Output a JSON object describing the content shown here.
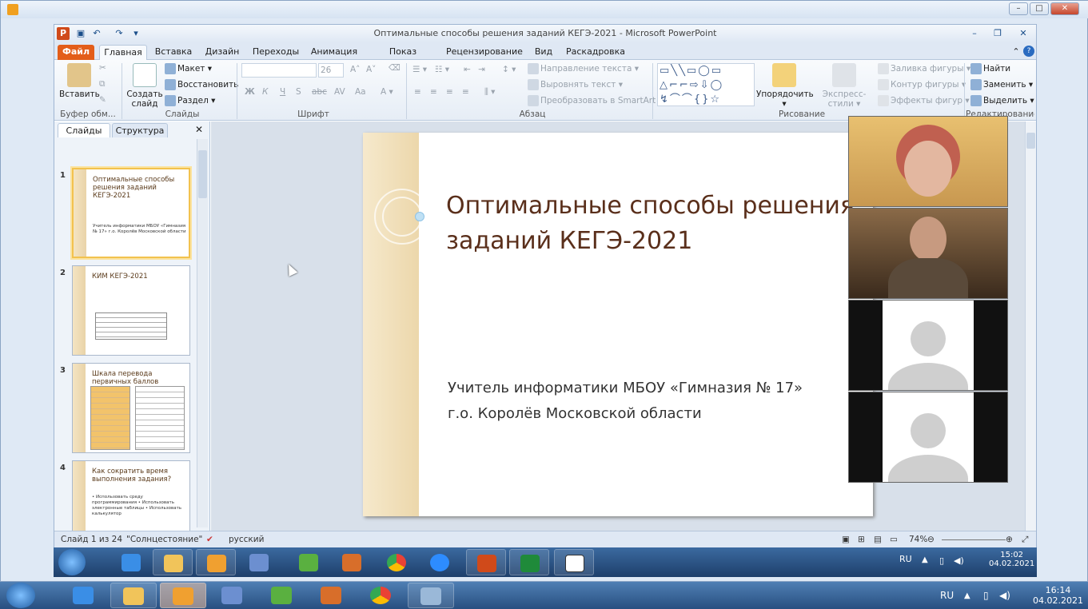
{
  "ppt": {
    "title": "Оптимальные способы решения заданий КЕГЭ-2021  -  Microsoft PowerPoint",
    "tabs": [
      "Файл",
      "Главная",
      "Вставка",
      "Дизайн",
      "Переходы",
      "Анимация",
      "Показ слайдов",
      "Рецензирование",
      "Вид",
      "Раскадровка"
    ]
  },
  "ribbon": {
    "clipboard": {
      "paste": "Вставить",
      "label": "Буфер обм..."
    },
    "slides": {
      "new_slide": "Создать слайд",
      "layout": "Макет",
      "reset": "Восстановить",
      "section": "Раздел",
      "label": "Слайды"
    },
    "font": {
      "size": "26",
      "bold": "Ж",
      "italic": "К",
      "underline": "Ч",
      "strike": "abc",
      "label": "Шрифт"
    },
    "paragraph": {
      "text_dir": "Направление текста",
      "align_text": "Выровнять текст",
      "smartart": "Преобразовать в SmartArt",
      "label": "Абзац"
    },
    "drawing": {
      "arrange": "Упорядочить",
      "styles": "Экспресс-стили",
      "fill": "Заливка фигуры",
      "outline": "Контур фигуры",
      "effects": "Эффекты фигур",
      "label": "Рисование"
    },
    "editing": {
      "find": "Найти",
      "replace": "Заменить",
      "select": "Выделить",
      "label": "Редактирование"
    }
  },
  "left_pane": {
    "tab_slides": "Слайды",
    "tab_outline": "Структура",
    "thumbs": [
      {
        "num": "1",
        "title": "Оптимальные способы решения заданий КЕГЭ-2021",
        "sub": "Учитель информатики МБОУ «Гимназия № 17» г.о. Королёв Московской области"
      },
      {
        "num": "2",
        "title": "КИМ КЕГЭ-2021",
        "sub": ""
      },
      {
        "num": "3",
        "title": "Шкала перевода первичных баллов",
        "sub": ""
      },
      {
        "num": "4",
        "title": "Как сократить время выполнения задания?",
        "sub": "• Использовать среду программирования • Использовать электронные таблицы • Использовать калькулятор"
      }
    ]
  },
  "slide": {
    "title": "Оптимальные способы решения заданий КЕГЭ-2021",
    "subtitle_line1": "Учитель информатики МБОУ «Гимназия № 17»",
    "subtitle_line2": "г.о. Королёв Московской области"
  },
  "status": {
    "slide": "Слайд 1 из 24",
    "theme": "\"Солнцестояние\"",
    "lang": "русский",
    "zoom": "74%"
  },
  "inner_tray": {
    "lang": "RU",
    "time": "15:02",
    "date": "04.02.2021"
  },
  "outer_tray": {
    "lang": "RU",
    "time": "16:14",
    "date": "04.02.2021"
  },
  "colors": {
    "file_tab": "#e35d19",
    "title_brown": "#5a2f1b",
    "taskbar": "#284f80"
  }
}
